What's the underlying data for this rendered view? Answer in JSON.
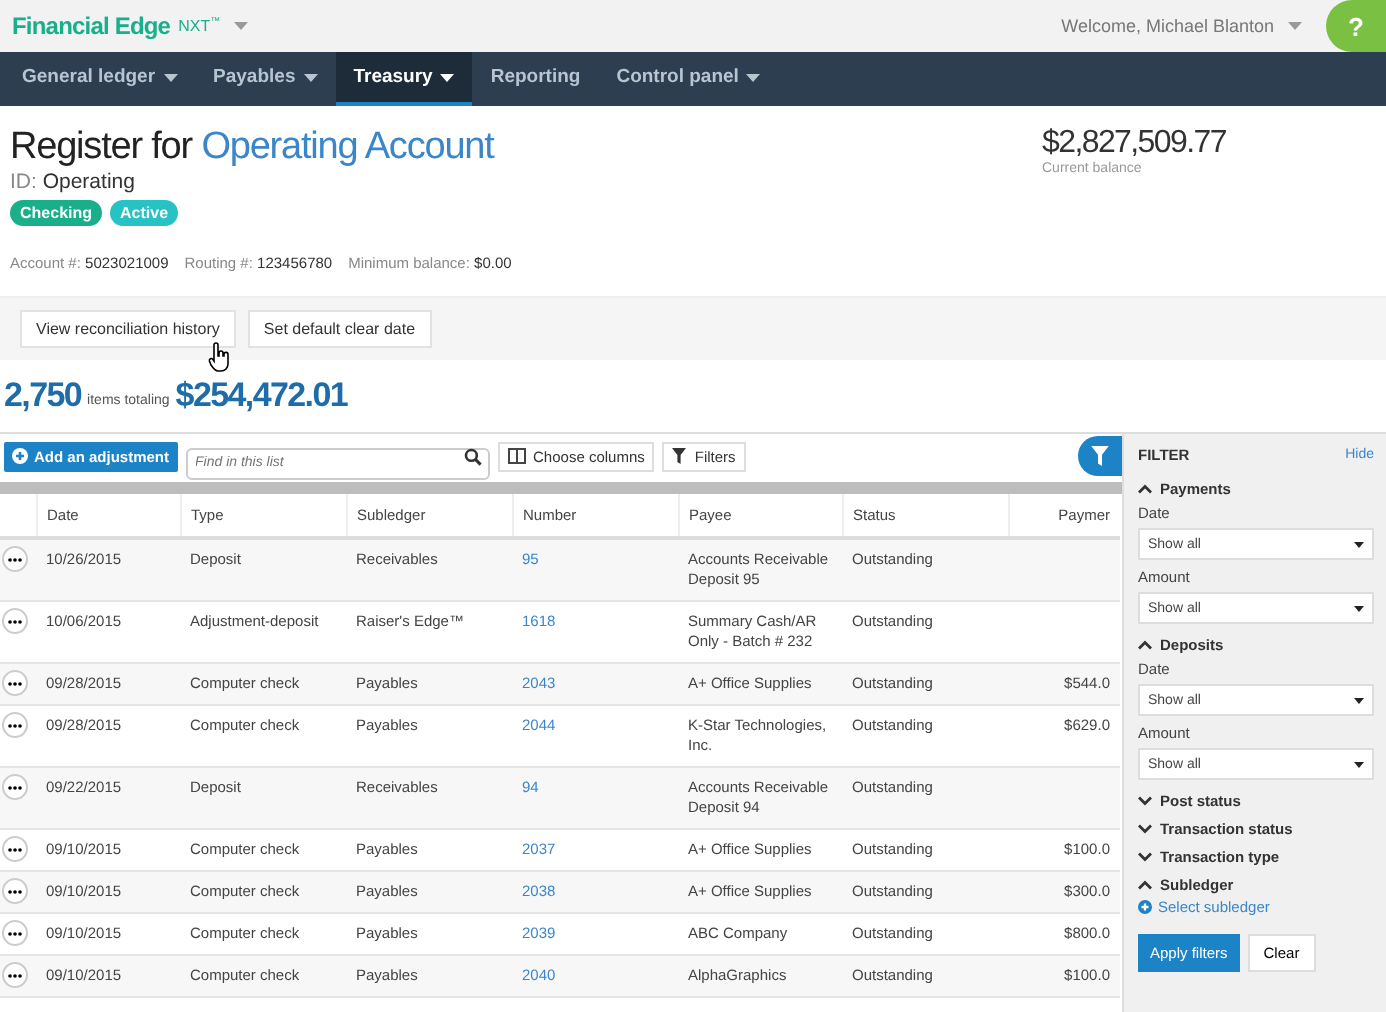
{
  "app": {
    "brand": "Financial Edge",
    "edition": "NXT",
    "trademark": "™",
    "welcome": "Welcome, Michael Blanton",
    "help": "?"
  },
  "nav": [
    {
      "label": "General ledger",
      "has_menu": true,
      "selected": false
    },
    {
      "label": "Payables",
      "has_menu": true,
      "selected": false
    },
    {
      "label": "Treasury",
      "has_menu": true,
      "selected": true
    },
    {
      "label": "Reporting",
      "has_menu": false,
      "selected": false
    },
    {
      "label": "Control panel",
      "has_menu": true,
      "selected": false
    }
  ],
  "header": {
    "title_prefix": "Register for",
    "title_account": "Operating Account",
    "id_label": "ID:",
    "id_value": "Operating",
    "badges": [
      {
        "label": "Checking",
        "color": "#1aaf8b"
      },
      {
        "label": "Active",
        "color": "#27c2c4"
      }
    ],
    "details": [
      {
        "label": "Account #:",
        "value": "5023021009"
      },
      {
        "label": "Routing #:",
        "value": "123456780"
      },
      {
        "label": "Minimum balance:",
        "value": "$0.00"
      }
    ],
    "balance": "$2,827,509.77",
    "balance_label": "Current balance"
  },
  "actions": [
    "View reconciliation history",
    "Set default clear date"
  ],
  "summary": {
    "count": "2,750",
    "text": "items totaling",
    "total": "$254,472.01"
  },
  "toolbar": {
    "add_button": "Add an adjustment",
    "search": {
      "placeholder": "Find in this list"
    },
    "choose_columns": "Choose columns",
    "filters": "Filters"
  },
  "table": {
    "columns": [
      "Date",
      "Type",
      "Subledger",
      "Number",
      "Payee",
      "Status",
      "Paymer"
    ],
    "rows": [
      {
        "date": "10/26/2015",
        "type": "Deposit",
        "subledger": "Receivables",
        "number": "95",
        "payee": "Accounts Receivable Deposit 95",
        "status": "Outstanding",
        "payment": ""
      },
      {
        "date": "10/06/2015",
        "type": "Adjustment-deposit",
        "subledger": "Raiser's Edge™",
        "number": "1618",
        "payee": "Summary Cash/AR Only - Batch # 232",
        "status": "Outstanding",
        "payment": ""
      },
      {
        "date": "09/28/2015",
        "type": "Computer check",
        "subledger": "Payables",
        "number": "2043",
        "payee": "A+ Office Supplies",
        "status": "Outstanding",
        "payment": "$544.0"
      },
      {
        "date": "09/28/2015",
        "type": "Computer check",
        "subledger": "Payables",
        "number": "2044",
        "payee": "K-Star Technologies, Inc.",
        "status": "Outstanding",
        "payment": "$629.0"
      },
      {
        "date": "09/22/2015",
        "type": "Deposit",
        "subledger": "Receivables",
        "number": "94",
        "payee": "Accounts Receivable Deposit 94",
        "status": "Outstanding",
        "payment": ""
      },
      {
        "date": "09/10/2015",
        "type": "Computer check",
        "subledger": "Payables",
        "number": "2037",
        "payee": "A+ Office Supplies",
        "status": "Outstanding",
        "payment": "$100.0"
      },
      {
        "date": "09/10/2015",
        "type": "Computer check",
        "subledger": "Payables",
        "number": "2038",
        "payee": "A+ Office Supplies",
        "status": "Outstanding",
        "payment": "$300.0"
      },
      {
        "date": "09/10/2015",
        "type": "Computer check",
        "subledger": "Payables",
        "number": "2039",
        "payee": "ABC Company",
        "status": "Outstanding",
        "payment": "$800.0"
      },
      {
        "date": "09/10/2015",
        "type": "Computer check",
        "subledger": "Payables",
        "number": "2040",
        "payee": "AlphaGraphics",
        "status": "Outstanding",
        "payment": "$100.0"
      }
    ]
  },
  "filter": {
    "title": "FILTER",
    "hide": "Hide",
    "sections": [
      {
        "label": "Payments",
        "expanded": true,
        "fields": [
          {
            "label": "Date",
            "value": "Show all"
          },
          {
            "label": "Amount",
            "value": "Show all"
          }
        ]
      },
      {
        "label": "Deposits",
        "expanded": true,
        "fields": [
          {
            "label": "Date",
            "value": "Show all"
          },
          {
            "label": "Amount",
            "value": "Show all"
          }
        ]
      },
      {
        "label": "Post status",
        "expanded": false
      },
      {
        "label": "Transaction status",
        "expanded": false
      },
      {
        "label": "Transaction type",
        "expanded": false
      },
      {
        "label": "Subledger",
        "expanded": true,
        "link": "Select subledger"
      }
    ],
    "apply": "Apply filters",
    "clear": "Clear"
  }
}
